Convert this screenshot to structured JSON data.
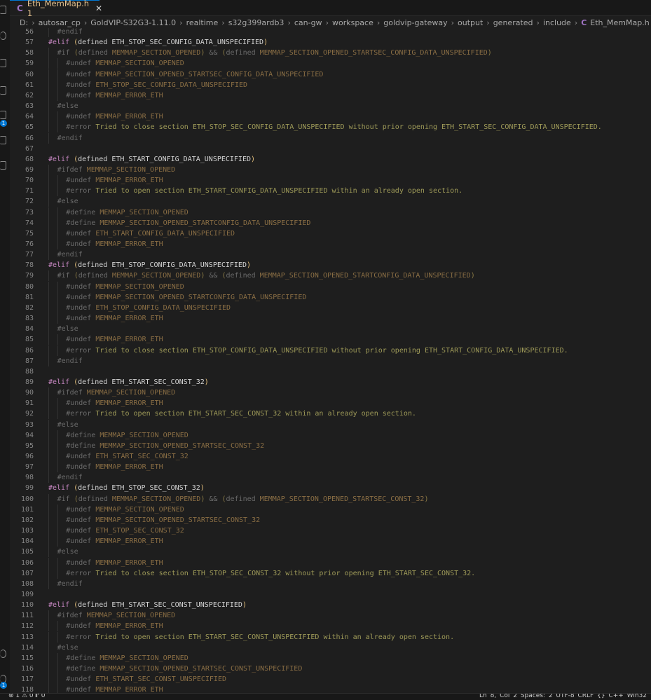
{
  "tab": {
    "label": "Eth_MemMap.h 1",
    "close": "✕",
    "file_icon": "C"
  },
  "breadcrumbs": [
    "D:",
    "autosar_cp",
    "GoldVIP-S32G3-1.11.0",
    "realtime",
    "s32g399ardb3",
    "can-gw",
    "workspace",
    "goldvip-gateway",
    "output",
    "generated",
    "include",
    "Eth_MemMap.h",
    "..."
  ],
  "activity_badges": [
    "1",
    "1"
  ],
  "code": [
    {
      "n": "56",
      "d": 1,
      "t": [
        [
          "dim",
          "#endif"
        ]
      ]
    },
    {
      "n": "57",
      "d": 0,
      "t": [
        [
          "kw",
          "#elif "
        ],
        [
          "mac",
          "("
        ],
        [
          "txt",
          "defined ETH_STOP_SEC_CONFIG_DATA_UNSPECIFIED"
        ],
        [
          "mac",
          ")"
        ]
      ]
    },
    {
      "n": "58",
      "d": 1,
      "t": [
        [
          "dim",
          "#if "
        ],
        [
          "dpar",
          "("
        ],
        [
          "dim",
          "defined "
        ],
        [
          "dmac",
          "MEMMAP_SECTION_OPENED"
        ],
        [
          "dpar",
          ")"
        ],
        [
          "dim",
          " && "
        ],
        [
          "dpar",
          "("
        ],
        [
          "dim",
          "defined "
        ],
        [
          "dmac",
          "MEMMAP_SECTION_OPENED_STARTSEC_CONFIG_DATA_UNSPECIFIED"
        ],
        [
          "dpar",
          ")"
        ]
      ]
    },
    {
      "n": "59",
      "d": 2,
      "t": [
        [
          "dim",
          "#undef "
        ],
        [
          "dmac",
          "MEMMAP_SECTION_OPENED"
        ]
      ]
    },
    {
      "n": "60",
      "d": 2,
      "t": [
        [
          "dim",
          "#undef "
        ],
        [
          "dmac",
          "MEMMAP_SECTION_OPENED_STARTSEC_CONFIG_DATA_UNSPECIFIED"
        ]
      ]
    },
    {
      "n": "61",
      "d": 2,
      "t": [
        [
          "dim",
          "#undef "
        ],
        [
          "dmac",
          "ETH_STOP_SEC_CONFIG_DATA_UNSPECIFIED"
        ]
      ]
    },
    {
      "n": "62",
      "d": 2,
      "t": [
        [
          "dim",
          "#undef "
        ],
        [
          "dmac",
          "MEMMAP_ERROR_ETH"
        ]
      ]
    },
    {
      "n": "63",
      "d": 1,
      "t": [
        [
          "dim",
          "#else"
        ]
      ]
    },
    {
      "n": "64",
      "d": 2,
      "t": [
        [
          "dim",
          "#undef "
        ],
        [
          "dmac",
          "MEMMAP_ERROR_ETH"
        ]
      ]
    },
    {
      "n": "65",
      "d": 2,
      "t": [
        [
          "dim",
          "#error "
        ],
        [
          "msg",
          "Tried to close section ETH_STOP_SEC_CONFIG_DATA_UNSPECIFIED without prior opening ETH_START_SEC_CONFIG_DATA_UNSPECIFIED."
        ]
      ]
    },
    {
      "n": "66",
      "d": 1,
      "t": [
        [
          "dim",
          "#endif"
        ]
      ]
    },
    {
      "n": "67",
      "d": 0,
      "t": []
    },
    {
      "n": "68",
      "d": 0,
      "t": [
        [
          "kw",
          "#elif "
        ],
        [
          "mac",
          "("
        ],
        [
          "txt",
          "defined ETH_START_CONFIG_DATA_UNSPECIFIED"
        ],
        [
          "mac",
          ")"
        ]
      ]
    },
    {
      "n": "69",
      "d": 1,
      "t": [
        [
          "dim",
          "#ifdef "
        ],
        [
          "dmac",
          "MEMMAP_SECTION_OPENED"
        ]
      ]
    },
    {
      "n": "70",
      "d": 2,
      "t": [
        [
          "dim",
          "#undef "
        ],
        [
          "dmac",
          "MEMMAP_ERROR_ETH"
        ]
      ]
    },
    {
      "n": "71",
      "d": 2,
      "t": [
        [
          "dim",
          "#error "
        ],
        [
          "msg",
          "Tried to open section ETH_START_CONFIG_DATA_UNSPECIFIED within an already open section."
        ]
      ]
    },
    {
      "n": "72",
      "d": 1,
      "t": [
        [
          "dim",
          "#else"
        ]
      ]
    },
    {
      "n": "73",
      "d": 2,
      "t": [
        [
          "dim",
          "#define "
        ],
        [
          "dmac",
          "MEMMAP_SECTION_OPENED"
        ]
      ]
    },
    {
      "n": "74",
      "d": 2,
      "t": [
        [
          "dim",
          "#define "
        ],
        [
          "dmac",
          "MEMMAP_SECTION_OPENED_STARTCONFIG_DATA_UNSPECIFIED"
        ]
      ]
    },
    {
      "n": "75",
      "d": 2,
      "t": [
        [
          "dim",
          "#undef "
        ],
        [
          "dmac",
          "ETH_START_CONFIG_DATA_UNSPECIFIED"
        ]
      ]
    },
    {
      "n": "76",
      "d": 2,
      "t": [
        [
          "dim",
          "#undef "
        ],
        [
          "dmac",
          "MEMMAP_ERROR_ETH"
        ]
      ]
    },
    {
      "n": "77",
      "d": 1,
      "t": [
        [
          "dim",
          "#endif"
        ]
      ]
    },
    {
      "n": "78",
      "d": 0,
      "t": [
        [
          "kw",
          "#elif "
        ],
        [
          "mac",
          "("
        ],
        [
          "txt",
          "defined ETH_STOP_CONFIG_DATA_UNSPECIFIED"
        ],
        [
          "mac",
          ")"
        ]
      ]
    },
    {
      "n": "79",
      "d": 1,
      "t": [
        [
          "dim",
          "#if "
        ],
        [
          "dpar",
          "("
        ],
        [
          "dim",
          "defined "
        ],
        [
          "dmac",
          "MEMMAP_SECTION_OPENED"
        ],
        [
          "dpar",
          ")"
        ],
        [
          "dim",
          " && "
        ],
        [
          "dpar",
          "("
        ],
        [
          "dim",
          "defined "
        ],
        [
          "dmac",
          "MEMMAP_SECTION_OPENED_STARTCONFIG_DATA_UNSPECIFIED"
        ],
        [
          "dpar",
          ")"
        ]
      ]
    },
    {
      "n": "80",
      "d": 2,
      "t": [
        [
          "dim",
          "#undef "
        ],
        [
          "dmac",
          "MEMMAP_SECTION_OPENED"
        ]
      ]
    },
    {
      "n": "81",
      "d": 2,
      "t": [
        [
          "dim",
          "#undef "
        ],
        [
          "dmac",
          "MEMMAP_SECTION_OPENED_STARTCONFIG_DATA_UNSPECIFIED"
        ]
      ]
    },
    {
      "n": "82",
      "d": 2,
      "t": [
        [
          "dim",
          "#undef "
        ],
        [
          "dmac",
          "ETH_STOP_CONFIG_DATA_UNSPECIFIED"
        ]
      ]
    },
    {
      "n": "83",
      "d": 2,
      "t": [
        [
          "dim",
          "#undef "
        ],
        [
          "dmac",
          "MEMMAP_ERROR_ETH"
        ]
      ]
    },
    {
      "n": "84",
      "d": 1,
      "t": [
        [
          "dim",
          "#else"
        ]
      ]
    },
    {
      "n": "85",
      "d": 2,
      "t": [
        [
          "dim",
          "#undef "
        ],
        [
          "dmac",
          "MEMMAP_ERROR_ETH"
        ]
      ]
    },
    {
      "n": "86",
      "d": 2,
      "t": [
        [
          "dim",
          "#error "
        ],
        [
          "msg",
          "Tried to close section ETH_STOP_CONFIG_DATA_UNSPECIFIED without prior opening ETH_START_CONFIG_DATA_UNSPECIFIED."
        ]
      ]
    },
    {
      "n": "87",
      "d": 1,
      "t": [
        [
          "dim",
          "#endif"
        ]
      ]
    },
    {
      "n": "88",
      "d": 0,
      "t": []
    },
    {
      "n": "89",
      "d": 0,
      "t": [
        [
          "kw",
          "#elif "
        ],
        [
          "mac",
          "("
        ],
        [
          "txt",
          "defined ETH_START_SEC_CONST_32"
        ],
        [
          "mac",
          ")"
        ]
      ]
    },
    {
      "n": "90",
      "d": 1,
      "t": [
        [
          "dim",
          "#ifdef "
        ],
        [
          "dmac",
          "MEMMAP_SECTION_OPENED"
        ]
      ]
    },
    {
      "n": "91",
      "d": 2,
      "t": [
        [
          "dim",
          "#undef "
        ],
        [
          "dmac",
          "MEMMAP_ERROR_ETH"
        ]
      ]
    },
    {
      "n": "92",
      "d": 2,
      "t": [
        [
          "dim",
          "#error "
        ],
        [
          "msg",
          "Tried to open section ETH_START_SEC_CONST_32 within an already open section."
        ]
      ]
    },
    {
      "n": "93",
      "d": 1,
      "t": [
        [
          "dim",
          "#else"
        ]
      ]
    },
    {
      "n": "94",
      "d": 2,
      "t": [
        [
          "dim",
          "#define "
        ],
        [
          "dmac",
          "MEMMAP_SECTION_OPENED"
        ]
      ]
    },
    {
      "n": "95",
      "d": 2,
      "t": [
        [
          "dim",
          "#define "
        ],
        [
          "dmac",
          "MEMMAP_SECTION_OPENED_STARTSEC_CONST_32"
        ]
      ]
    },
    {
      "n": "96",
      "d": 2,
      "t": [
        [
          "dim",
          "#undef "
        ],
        [
          "dmac",
          "ETH_START_SEC_CONST_32"
        ]
      ]
    },
    {
      "n": "97",
      "d": 2,
      "t": [
        [
          "dim",
          "#undef "
        ],
        [
          "dmac",
          "MEMMAP_ERROR_ETH"
        ]
      ]
    },
    {
      "n": "98",
      "d": 1,
      "t": [
        [
          "dim",
          "#endif"
        ]
      ]
    },
    {
      "n": "99",
      "d": 0,
      "t": [
        [
          "kw",
          "#elif "
        ],
        [
          "mac",
          "("
        ],
        [
          "txt",
          "defined ETH_STOP_SEC_CONST_32"
        ],
        [
          "mac",
          ")"
        ]
      ]
    },
    {
      "n": "100",
      "d": 1,
      "t": [
        [
          "dim",
          "#if "
        ],
        [
          "dpar",
          "("
        ],
        [
          "dim",
          "defined "
        ],
        [
          "dmac",
          "MEMMAP_SECTION_OPENED"
        ],
        [
          "dpar",
          ")"
        ],
        [
          "dim",
          " && "
        ],
        [
          "dpar",
          "("
        ],
        [
          "dim",
          "defined "
        ],
        [
          "dmac",
          "MEMMAP_SECTION_OPENED_STARTSEC_CONST_32"
        ],
        [
          "dpar",
          ")"
        ]
      ]
    },
    {
      "n": "101",
      "d": 2,
      "t": [
        [
          "dim",
          "#undef "
        ],
        [
          "dmac",
          "MEMMAP_SECTION_OPENED"
        ]
      ]
    },
    {
      "n": "102",
      "d": 2,
      "t": [
        [
          "dim",
          "#undef "
        ],
        [
          "dmac",
          "MEMMAP_SECTION_OPENED_STARTSEC_CONST_32"
        ]
      ]
    },
    {
      "n": "103",
      "d": 2,
      "t": [
        [
          "dim",
          "#undef "
        ],
        [
          "dmac",
          "ETH_STOP_SEC_CONST_32"
        ]
      ]
    },
    {
      "n": "104",
      "d": 2,
      "t": [
        [
          "dim",
          "#undef "
        ],
        [
          "dmac",
          "MEMMAP_ERROR_ETH"
        ]
      ]
    },
    {
      "n": "105",
      "d": 1,
      "t": [
        [
          "dim",
          "#else"
        ]
      ]
    },
    {
      "n": "106",
      "d": 2,
      "t": [
        [
          "dim",
          "#undef "
        ],
        [
          "dmac",
          "MEMMAP_ERROR_ETH"
        ]
      ]
    },
    {
      "n": "107",
      "d": 2,
      "t": [
        [
          "dim",
          "#error "
        ],
        [
          "msg",
          "Tried to close section ETH_STOP_SEC_CONST_32 without prior opening ETH_START_SEC_CONST_32."
        ]
      ]
    },
    {
      "n": "108",
      "d": 1,
      "t": [
        [
          "dim",
          "#endif"
        ]
      ]
    },
    {
      "n": "109",
      "d": 0,
      "t": []
    },
    {
      "n": "110",
      "d": 0,
      "t": [
        [
          "kw",
          "#elif "
        ],
        [
          "mac",
          "("
        ],
        [
          "txt",
          "defined ETH_START_SEC_CONST_UNSPECIFIED"
        ],
        [
          "mac",
          ")"
        ]
      ]
    },
    {
      "n": "111",
      "d": 1,
      "t": [
        [
          "dim",
          "#ifdef "
        ],
        [
          "dmac",
          "MEMMAP_SECTION_OPENED"
        ]
      ]
    },
    {
      "n": "112",
      "d": 2,
      "t": [
        [
          "dim",
          "#undef "
        ],
        [
          "dmac",
          "MEMMAP_ERROR_ETH"
        ]
      ]
    },
    {
      "n": "113",
      "d": 2,
      "t": [
        [
          "dim",
          "#error "
        ],
        [
          "msg",
          "Tried to open section ETH_START_SEC_CONST_UNSPECIFIED within an already open section."
        ]
      ]
    },
    {
      "n": "114",
      "d": 1,
      "t": [
        [
          "dim",
          "#else"
        ]
      ]
    },
    {
      "n": "115",
      "d": 2,
      "t": [
        [
          "dim",
          "#define "
        ],
        [
          "dmac",
          "MEMMAP_SECTION_OPENED"
        ]
      ]
    },
    {
      "n": "116",
      "d": 2,
      "t": [
        [
          "dim",
          "#define "
        ],
        [
          "dmac",
          "MEMMAP_SECTION_OPENED_STARTSEC_CONST_UNSPECIFIED"
        ]
      ]
    },
    {
      "n": "117",
      "d": 2,
      "t": [
        [
          "dim",
          "#undef "
        ],
        [
          "dmac",
          "ETH_START_SEC_CONST_UNSPECIFIED"
        ]
      ]
    },
    {
      "n": "118",
      "d": 2,
      "t": [
        [
          "dim",
          "#undef "
        ],
        [
          "dmac",
          "MEMMAP_ERROR_ETH"
        ]
      ]
    }
  ],
  "status": {
    "left": "⊗ 1 ⚠ 0   ⑈ 0",
    "right": "Ln 8, Col 2   Spaces: 2   UTF-8   CRLF   {} C++   Win32"
  }
}
